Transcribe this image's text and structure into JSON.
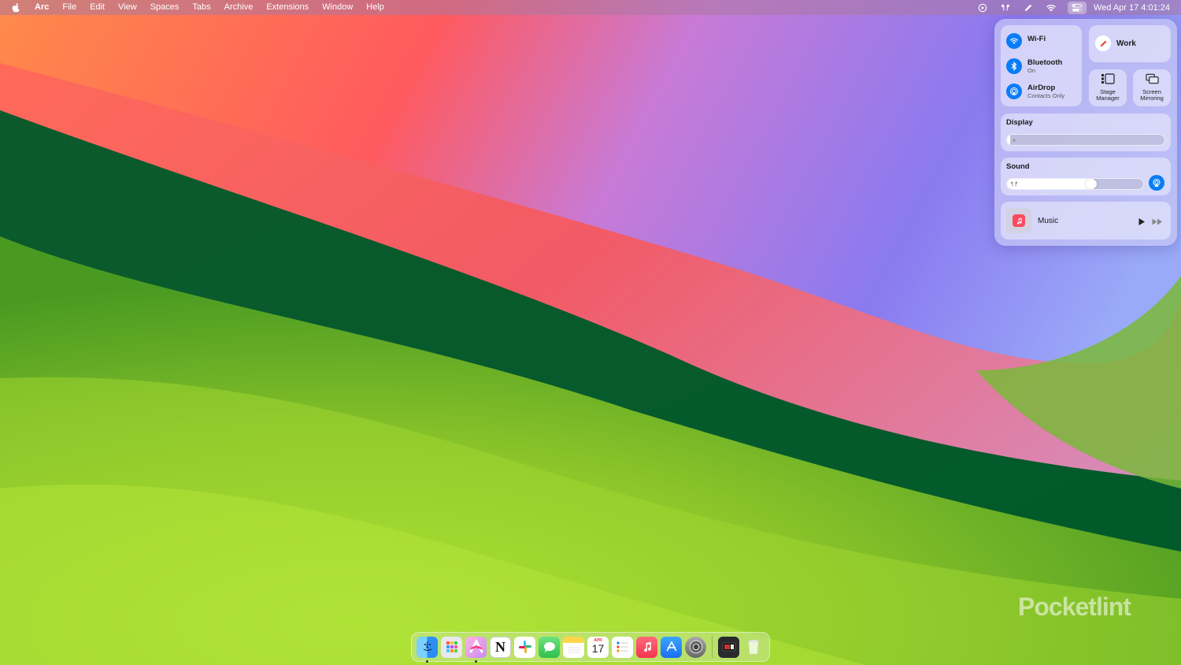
{
  "menubar": {
    "app_name": "Arc",
    "menus": [
      "File",
      "Edit",
      "View",
      "Spaces",
      "Tabs",
      "Archive",
      "Extensions",
      "Window",
      "Help"
    ],
    "status_icons": [
      "screen-record-icon",
      "airpods-icon",
      "pen-icon",
      "wifi-icon",
      "control-center-icon"
    ],
    "clock": "Wed Apr 17  4:01:24"
  },
  "control_center": {
    "wifi": {
      "label": "Wi-Fi"
    },
    "bluetooth": {
      "label": "Bluetooth",
      "status": "On"
    },
    "airdrop": {
      "label": "AirDrop",
      "status": "Contacts Only"
    },
    "focus": {
      "label": "Work"
    },
    "stage_manager": {
      "label": "Stage Manager"
    },
    "screen_mirroring": {
      "label": "Screen Mirroring"
    },
    "display": {
      "label": "Display",
      "level": 0.02
    },
    "sound": {
      "label": "Sound",
      "level": 0.61
    },
    "music": {
      "label": "Music"
    }
  },
  "watermark": "Pocketlint",
  "dock": {
    "apps": [
      {
        "name": "finder",
        "running": true,
        "color": "#3aa0f5"
      },
      {
        "name": "launchpad",
        "running": false,
        "color": "#e8e8ee"
      },
      {
        "name": "arc",
        "running": true,
        "color": "#f4a7d0"
      },
      {
        "name": "notion",
        "running": false,
        "color": "#ffffff"
      },
      {
        "name": "slack",
        "running": false,
        "color": "#ffffff"
      },
      {
        "name": "messages",
        "running": false,
        "color": "#3ad35a"
      },
      {
        "name": "notes",
        "running": false,
        "color": "#fde58a"
      },
      {
        "name": "calendar",
        "running": false,
        "color": "#ffffff"
      },
      {
        "name": "reminders",
        "running": false,
        "color": "#ffffff"
      },
      {
        "name": "music",
        "running": false,
        "color": "#fa4a5e"
      },
      {
        "name": "app-store",
        "running": false,
        "color": "#2d8cf5"
      },
      {
        "name": "system-settings",
        "running": false,
        "color": "#8a8a8f"
      }
    ],
    "calendar_month": "APR",
    "calendar_day": "17",
    "notion_glyph": "N",
    "trash_label": "trash"
  }
}
